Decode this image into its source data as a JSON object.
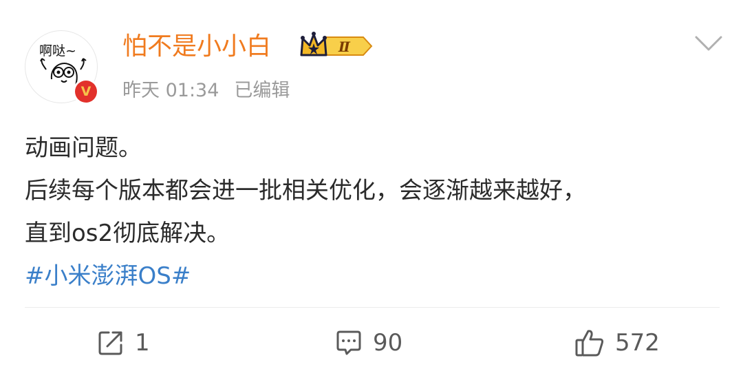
{
  "post": {
    "avatar": {
      "text": "啊哒~"
    },
    "author": {
      "name": "怕不是小小白",
      "rank_badge": "Ⅱ",
      "verified_mark": "V"
    },
    "meta": {
      "time": "昨天 01:34",
      "edited": "已编辑"
    },
    "content": {
      "lines": [
        "动画问题。",
        "后续每个版本都会进一批相关优化，会逐渐越来越好，",
        "直到os2彻底解决。"
      ],
      "hashtag": "#小米澎湃OS#"
    },
    "actions": {
      "share_count": "1",
      "comment_count": "90",
      "like_count": "572"
    },
    "colors": {
      "username": "#f07b1f",
      "hashtag": "#3a7fc9",
      "meta": "#9a9a9a",
      "verified": "#e2312b"
    },
    "icons": [
      "chevron-down-icon",
      "share-icon",
      "comment-icon",
      "like-icon",
      "crown-icon",
      "verified-icon"
    ]
  }
}
